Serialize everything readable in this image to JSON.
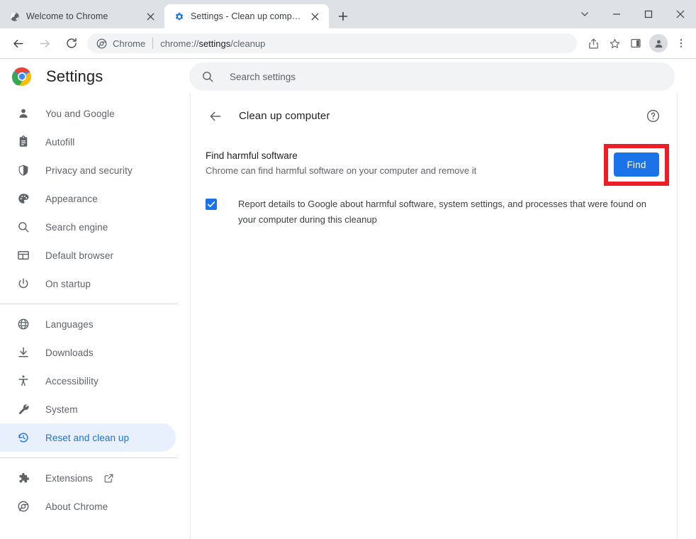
{
  "window": {
    "controls": [
      {
        "name": "tab-search",
        "glyph": "chevron-down"
      },
      {
        "name": "minimize",
        "glyph": "minus"
      },
      {
        "name": "maximize",
        "glyph": "square"
      },
      {
        "name": "close",
        "glyph": "x"
      }
    ]
  },
  "tabs": [
    {
      "title": "Welcome to Chrome",
      "favicon": "globe-icon",
      "active": false
    },
    {
      "title": "Settings - Clean up computer",
      "favicon": "gear-icon",
      "active": true
    }
  ],
  "new_tab_label": "+",
  "toolbar": {
    "back": "back-arrow-icon",
    "forward": "forward-arrow-icon",
    "reload": "reload-icon",
    "omnibox": {
      "chip_icon": "chrome-icon",
      "chip_label": "Chrome",
      "url_prefix": "chrome://",
      "url_bold": "settings",
      "url_suffix": "/cleanup",
      "full_url": "chrome://settings/cleanup"
    },
    "actions": [
      {
        "name": "share-icon"
      },
      {
        "name": "bookmark-star-icon"
      },
      {
        "name": "side-panel-icon"
      },
      {
        "name": "profile-avatar"
      },
      {
        "name": "three-dot-menu-icon"
      }
    ]
  },
  "settings_header": {
    "logo": "chrome-logo",
    "title": "Settings"
  },
  "search": {
    "icon": "search-icon",
    "placeholder": "Search settings",
    "value": ""
  },
  "sidebar": {
    "groups": [
      {
        "items": [
          {
            "label": "You and Google",
            "icon": "person-icon",
            "selected": false
          },
          {
            "label": "Autofill",
            "icon": "clipboard-icon",
            "selected": false
          },
          {
            "label": "Privacy and security",
            "icon": "shield-icon",
            "selected": false
          },
          {
            "label": "Appearance",
            "icon": "palette-icon",
            "selected": false
          },
          {
            "label": "Search engine",
            "icon": "search-icon",
            "selected": false
          },
          {
            "label": "Default browser",
            "icon": "browser-window-icon",
            "selected": false
          },
          {
            "label": "On startup",
            "icon": "power-icon",
            "selected": false
          }
        ]
      },
      {
        "items": [
          {
            "label": "Languages",
            "icon": "globe-icon",
            "selected": false
          },
          {
            "label": "Downloads",
            "icon": "download-icon",
            "selected": false
          },
          {
            "label": "Accessibility",
            "icon": "accessibility-icon",
            "selected": false
          },
          {
            "label": "System",
            "icon": "wrench-icon",
            "selected": false
          },
          {
            "label": "Reset and clean up",
            "icon": "history-restore-icon",
            "selected": true
          }
        ]
      },
      {
        "items": [
          {
            "label": "Extensions",
            "icon": "puzzle-icon",
            "selected": false,
            "external": true
          },
          {
            "label": "About Chrome",
            "icon": "chrome-outline-icon",
            "selected": false
          }
        ]
      }
    ]
  },
  "content": {
    "back_icon": "back-arrow-icon",
    "title": "Clean up computer",
    "help_icon": "help-circle-icon",
    "find_section": {
      "title": "Find harmful software",
      "subtitle": "Chrome can find harmful software on your computer and remove it",
      "button_label": "Find",
      "highlight_color": "#ee1c25",
      "button_color": "#1a73e8"
    },
    "report_checkbox": {
      "checked": true,
      "label": "Report details to Google about harmful software, system settings, and processes that were found on your computer during this cleanup"
    }
  },
  "colors": {
    "accent": "#1a73e8",
    "selected_bg": "#e8f0fe",
    "tabstrip_bg": "#dee1e6",
    "highlight_red": "#ee1c25"
  }
}
